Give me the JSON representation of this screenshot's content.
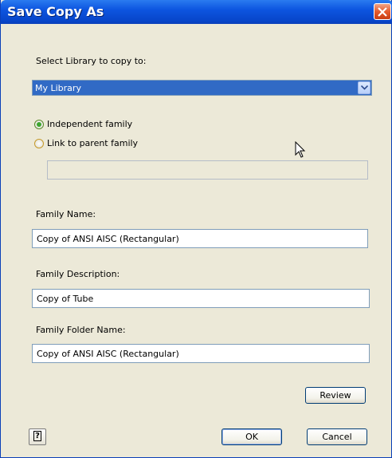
{
  "window": {
    "title": "Save Copy As"
  },
  "library": {
    "label": "Select Library to copy to:",
    "selected": "My Library"
  },
  "options": {
    "independent_label": "Independent family",
    "link_label": "Link to parent family",
    "selected": "independent",
    "parent_family_value": ""
  },
  "family_name": {
    "label": "Family Name:",
    "value": "Copy of ANSI AISC (Rectangular)"
  },
  "family_description": {
    "label": "Family Description:",
    "value": "Copy of Tube"
  },
  "family_folder": {
    "label": "Family Folder Name:",
    "value": "Copy of ANSI AISC (Rectangular)"
  },
  "buttons": {
    "review": "Review",
    "ok": "OK",
    "cancel": "Cancel",
    "help": "?"
  },
  "colors": {
    "title_bar": "#0a55e0",
    "selection": "#316ac5",
    "close": "#e55b2e"
  }
}
